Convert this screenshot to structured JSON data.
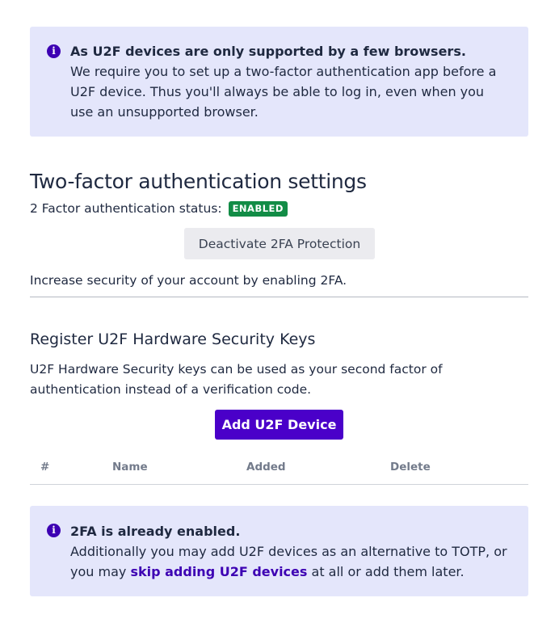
{
  "alert_top": {
    "icon": "info-icon",
    "title": "As U2F devices are only supported by a few browsers.",
    "text": "We require you to set up a two-factor authentication app before a U2F device. Thus you'll always be able to log in, even when you use an unsupported browser."
  },
  "twofa": {
    "heading": "Two-factor authentication settings",
    "status_label": "2 Factor authentication status:",
    "status_badge": "ENABLED",
    "deactivate_button": "Deactivate 2FA Protection",
    "increase_text": "Increase security of your account by enabling 2FA."
  },
  "u2f": {
    "heading": "Register U2F Hardware Security Keys",
    "description": "U2F Hardware Security keys can be used as your second factor of authentication instead of a verification code.",
    "add_button": "Add U2F Device",
    "table_headers": [
      "#",
      "Name",
      "Added",
      "Delete"
    ]
  },
  "alert_bottom": {
    "icon": "info-icon",
    "title": "2FA is already enabled.",
    "text_before": "Additionally you may add U2F devices as an alternative to TOTP, or you may ",
    "link_text": "skip adding U2F devices",
    "text_after": " at all or add them later."
  },
  "colors": {
    "accent": "#4a00c9",
    "alert_bg": "#e4e6fb",
    "badge_green": "#128c46"
  }
}
